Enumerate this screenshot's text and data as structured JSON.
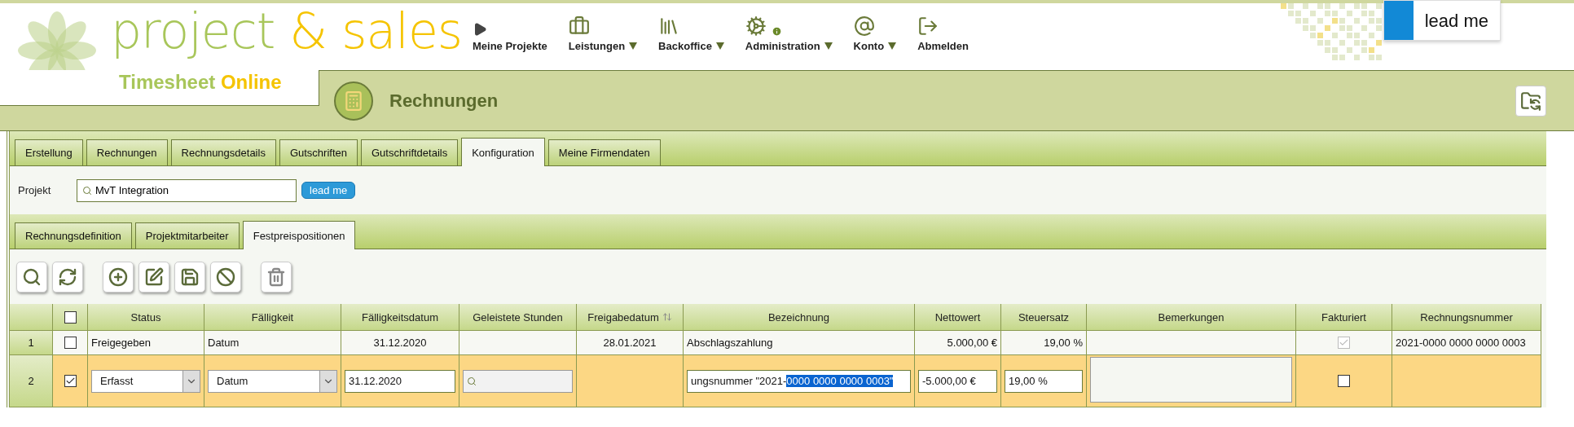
{
  "logo": {
    "title_part1": "project",
    "title_part2": "& sales",
    "subtitle_part1": "Timesheet",
    "subtitle_part2": "Online"
  },
  "nav": [
    {
      "label": "Meine Projekte",
      "has_menu": false,
      "info_badge": false
    },
    {
      "label": "Leistungen",
      "has_menu": true,
      "info_badge": false
    },
    {
      "label": "Backoffice",
      "has_menu": true,
      "info_badge": false
    },
    {
      "label": "Administration",
      "has_menu": true,
      "info_badge": true
    },
    {
      "label": "Konto",
      "has_menu": true,
      "info_badge": false
    },
    {
      "label": "Abmelden",
      "has_menu": false,
      "info_badge": false
    }
  ],
  "lead_me_button": "lead me",
  "section_title": "Rechnungen",
  "tabs": [
    {
      "label": "Erstellung",
      "selected": false
    },
    {
      "label": "Rechnungen",
      "selected": false
    },
    {
      "label": "Rechnungsdetails",
      "selected": false
    },
    {
      "label": "Gutschriften",
      "selected": false
    },
    {
      "label": "Gutschriftdetails",
      "selected": false
    },
    {
      "label": "Konfiguration",
      "selected": true
    },
    {
      "label": "Meine Firmendaten",
      "selected": false
    }
  ],
  "project": {
    "label": "Projekt",
    "value": "MvT Integration",
    "lead_me": "lead me"
  },
  "subtabs": [
    {
      "label": "Rechnungsdefinition",
      "selected": false
    },
    {
      "label": "Projektmitarbeiter",
      "selected": false
    },
    {
      "label": "Festpreispositionen",
      "selected": true
    }
  ],
  "toolbar": [
    [
      {
        "kind": "search"
      },
      {
        "kind": "refresh"
      }
    ],
    [
      {
        "kind": "add"
      },
      {
        "kind": "edit"
      },
      {
        "kind": "save"
      },
      {
        "kind": "cancel"
      }
    ],
    [
      {
        "kind": "delete"
      }
    ]
  ],
  "table": {
    "columns": [
      {
        "kind": "number"
      },
      {
        "kind": "checkbox",
        "checked": false
      },
      {
        "kind": "text",
        "label": "Status"
      },
      {
        "kind": "text",
        "label": "Fälligkeit"
      },
      {
        "kind": "text",
        "label": "Fälligkeitsdatum"
      },
      {
        "kind": "text",
        "label": "Geleistete Stunden"
      },
      {
        "kind": "sortable",
        "label": "Freigabedatum"
      },
      {
        "kind": "text",
        "label": "Bezeichnung"
      },
      {
        "kind": "text",
        "label": "Nettowert"
      },
      {
        "kind": "text",
        "label": "Steuersatz"
      },
      {
        "kind": "text",
        "label": "Bemerkungen"
      },
      {
        "kind": "text",
        "label": "Fakturiert"
      },
      {
        "kind": "text",
        "label": "Rechnungsnummer"
      }
    ],
    "rows": [
      {
        "selected": false,
        "cells": [
          {
            "kind": "number",
            "text": "1"
          },
          {
            "kind": "check",
            "checked": false,
            "disabled": false
          },
          {
            "kind": "text",
            "text": "Freigegeben"
          },
          {
            "kind": "text",
            "text": "Datum"
          },
          {
            "kind": "text",
            "text": "31.12.2020"
          },
          {
            "kind": "empty"
          },
          {
            "kind": "text",
            "text": "28.01.2021"
          },
          {
            "kind": "text",
            "text": "Abschlagszahlung"
          },
          {
            "kind": "text",
            "text": "5.000,00 €"
          },
          {
            "kind": "text",
            "text": "19,00 %"
          },
          {
            "kind": "empty"
          },
          {
            "kind": "check",
            "checked": true,
            "disabled": true
          },
          {
            "kind": "text",
            "text": "2021-0000 0000 0000 0003"
          }
        ]
      },
      {
        "selected": true,
        "cells": [
          {
            "kind": "number",
            "text": "2"
          },
          {
            "kind": "check",
            "checked": true,
            "disabled": false
          },
          {
            "kind": "select",
            "value": "Erfasst"
          },
          {
            "kind": "select",
            "value": "Datum"
          },
          {
            "kind": "input",
            "value": "31.12.2020"
          },
          {
            "kind": "lookup"
          },
          {
            "kind": "empty"
          },
          {
            "kind": "input",
            "value": "ungsnummer \"2021-",
            "highlighted": "0000 0000 0000 0003\""
          },
          {
            "kind": "input",
            "value": "-5.000,00 €"
          },
          {
            "kind": "input",
            "value": "19,00 %"
          },
          {
            "kind": "textarea"
          },
          {
            "kind": "check",
            "checked": false,
            "disabled": false
          },
          {
            "kind": "empty"
          }
        ]
      }
    ]
  }
}
